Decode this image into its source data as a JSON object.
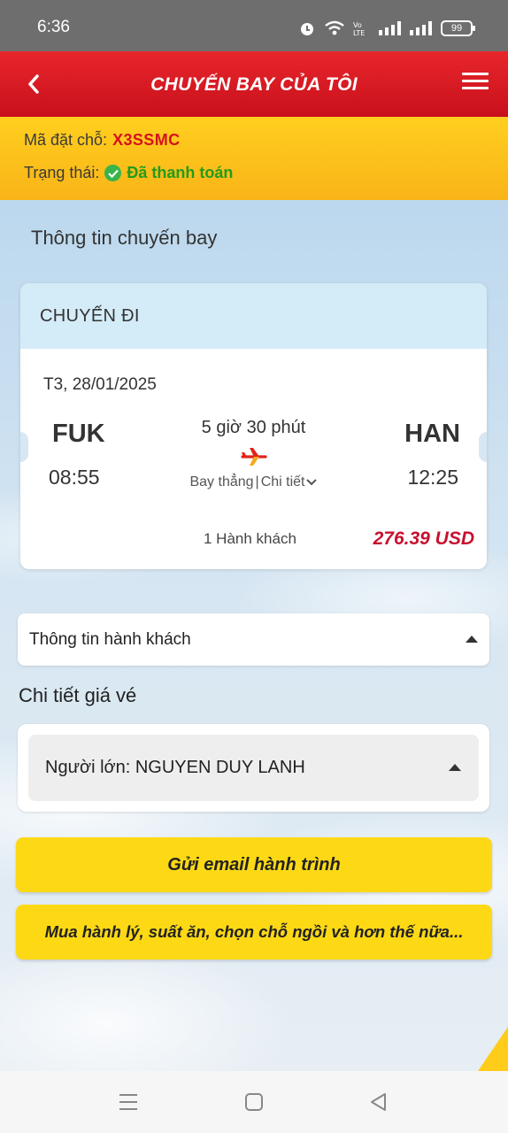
{
  "status_bar": {
    "time": "6:36",
    "battery": "99"
  },
  "header": {
    "title": "CHUYẾN BAY CỦA TÔI"
  },
  "booking": {
    "code_label": "Mã đặt chỗ:",
    "code_value": "X3SSMC",
    "status_label": "Trạng thái:",
    "status_value": "Đã thanh toán"
  },
  "flight_section_title": "Thông tin chuyến bay",
  "flight_card": {
    "header": "CHUYẾN ĐI",
    "date": "T3, 28/01/2025",
    "from_code": "FUK",
    "from_time": "08:55",
    "to_code": "HAN",
    "to_time": "12:25",
    "duration": "5 giờ 30 phút",
    "route_type": "Bay thẳng",
    "detail_link": "Chi tiết",
    "passengers": "1 Hành khách",
    "price": "276.39 USD"
  },
  "passenger_info": {
    "label": "Thông tin hành khách"
  },
  "fare": {
    "title": "Chi tiết giá vé",
    "passenger": "Người lớn: NGUYEN DUY LANH"
  },
  "buttons": {
    "email": "Gửi email hành trình",
    "extras": "Mua hành lý, suất ăn, chọn chỗ ngồi và hơn thế nữa..."
  },
  "colors": {
    "header_red": "#d4131b",
    "booking_yellow": "#fcc21b",
    "button_yellow": "#fdd915",
    "price_red": "#c8102e",
    "paid_green": "#219c1d"
  }
}
